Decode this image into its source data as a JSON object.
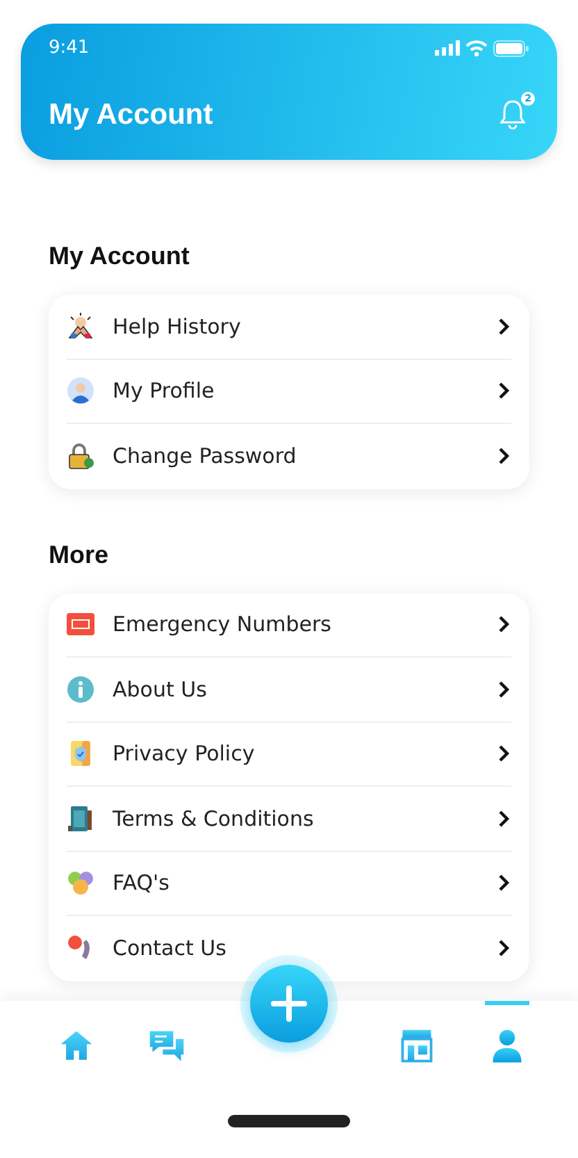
{
  "status_bar": {
    "time": "9:41"
  },
  "header": {
    "title": "My Account",
    "notification_count": "2"
  },
  "sections": [
    {
      "title": "My Account",
      "items": [
        {
          "label": "Help History"
        },
        {
          "label": "My Profile"
        },
        {
          "label": "Change Password"
        }
      ]
    },
    {
      "title": "More",
      "items": [
        {
          "label": "Emergency Numbers"
        },
        {
          "label": "About Us"
        },
        {
          "label": "Privacy Policy"
        },
        {
          "label": "Terms & Conditions"
        },
        {
          "label": "FAQ's"
        },
        {
          "label": "Contact Us"
        }
      ]
    }
  ],
  "bottom_nav": {
    "items": [
      {
        "selected": false
      },
      {
        "selected": false
      },
      {
        "selected": false
      },
      {
        "selected": true
      }
    ]
  }
}
